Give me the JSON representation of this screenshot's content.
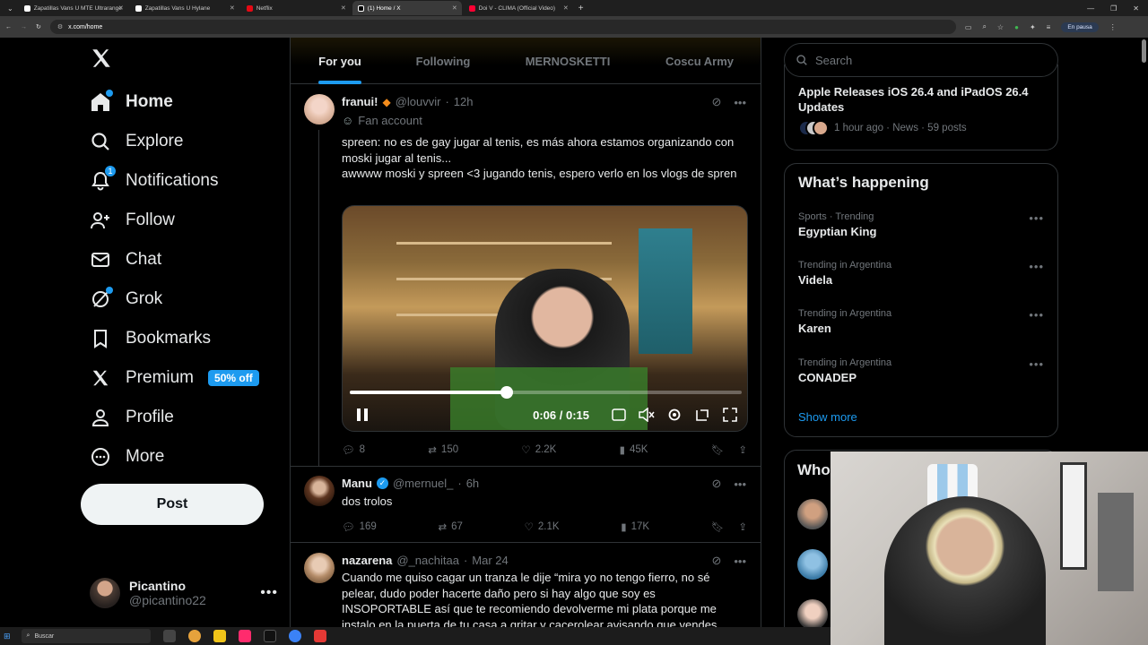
{
  "browser": {
    "tabs": [
      {
        "label": "Zapatillas Vans U MTE Ultrarange",
        "color": "#ffffff",
        "active": false
      },
      {
        "label": "Zapatillas Vans U Hylane",
        "color": "#ffffff",
        "active": false
      },
      {
        "label": "Netflix",
        "color": "#e50914",
        "active": false
      },
      {
        "label": "(1) Home / X",
        "color": "#ffffff",
        "active": true
      },
      {
        "label": "Doi V - CLIMA (Official Video)",
        "color": "#ff0033",
        "active": false
      }
    ],
    "url": "x.com/home",
    "pause_label": "En pausa"
  },
  "nav": {
    "items": [
      {
        "label": "Home",
        "icon": "home-icon"
      },
      {
        "label": "Explore",
        "icon": "search-icon"
      },
      {
        "label": "Notifications",
        "icon": "bell-icon",
        "badge": "1"
      },
      {
        "label": "Follow",
        "icon": "add-user-icon"
      },
      {
        "label": "Chat",
        "icon": "mail-icon"
      },
      {
        "label": "Grok",
        "icon": "grok-icon"
      },
      {
        "label": "Bookmarks",
        "icon": "bookmark-icon"
      },
      {
        "label": "Premium",
        "icon": "x-logo-icon",
        "pill": "50% off"
      },
      {
        "label": "Profile",
        "icon": "person-icon"
      },
      {
        "label": "More",
        "icon": "more-circle-icon"
      }
    ],
    "post_label": "Post",
    "account": {
      "name": "Picantino",
      "handle": "@picantino22"
    }
  },
  "feed": {
    "tabs": [
      "For you",
      "Following",
      "MERNOSKETTI",
      "Coscu Army"
    ],
    "tweets": [
      {
        "name": "franui!",
        "handle": "@louvvir",
        "time": "12h",
        "sub": "Fan account",
        "text": "spreen: no es de gay jugar al tenis, es más ahora estamos organizando con moski jugar al tenis...\nawwww moski y spreen <3 jugando tenis, espero verlo en los vlogs de spren",
        "video": {
          "time": "0:06 / 0:15",
          "progress": 0.4
        },
        "replies": "8",
        "reposts": "150",
        "likes": "2.2K",
        "views": "45K"
      },
      {
        "name": "Manu",
        "handle": "@mernuel_",
        "time": "6h",
        "text": "dos trolos",
        "replies": "169",
        "reposts": "67",
        "likes": "2.1K",
        "views": "17K"
      },
      {
        "name": "nazarena",
        "handle": "@_nachitaa",
        "time": "Mar 24",
        "text": "Cuando me quiso cagar un tranza le dije “mira yo no tengo fierro, no sé pelear, dudo poder hacerte daño pero si hay algo que soy es INSOPORTABLE así que te recomiendo devolverme mi plata porque me instalo en la puerta de tu casa a gritar y cacerolear avisando que vendes"
      }
    ]
  },
  "sidebar": {
    "search_placeholder": "Search",
    "news": {
      "title": "Apple Releases iOS 26.4 and iPadOS 26.4 Updates",
      "meta": "1 hour ago · News · 59 posts"
    },
    "happening_title": "What’s happening",
    "trends": [
      {
        "category": "Sports · Trending",
        "name": "Egyptian King"
      },
      {
        "category": "Trending in Argentina",
        "name": "Videla"
      },
      {
        "category": "Trending in Argentina",
        "name": "Karen"
      },
      {
        "category": "Trending in Argentina",
        "name": "CONADEP"
      }
    ],
    "show_more": "Show more",
    "who_title": "Who"
  },
  "taskbar": {
    "search_placeholder": "Buscar"
  }
}
